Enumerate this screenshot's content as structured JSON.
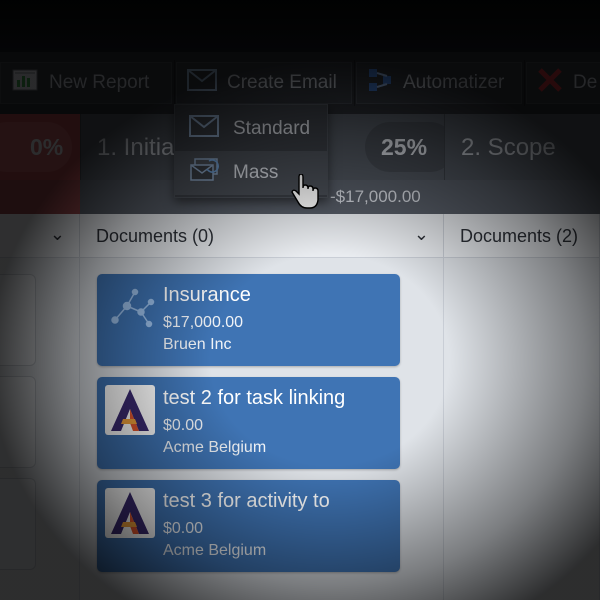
{
  "toolbar": {
    "new_report_label": "New Report",
    "create_email_label": "Create Email",
    "automatizer_label": "Automatizer",
    "delete_label": "De",
    "icons": [
      "report-icon",
      "envelope-icon",
      "flow-icon",
      "delete-x-icon"
    ]
  },
  "email_menu": {
    "items": [
      {
        "label": "Standard",
        "icon": "envelope-icon"
      },
      {
        "label": "Mass",
        "icon": "mass-email-icon"
      }
    ]
  },
  "stages": [
    {
      "pct": "0%",
      "title": "",
      "amount": ""
    },
    {
      "pct": "25%",
      "title": "1. Initia",
      "amount": "-$17,000.00"
    },
    {
      "pct": "",
      "title": "2. Scope",
      "amount": ""
    }
  ],
  "columns": [
    {
      "header": ""
    },
    {
      "header": "Documents (0)"
    },
    {
      "header": "Documents (2)"
    }
  ],
  "cards": [
    {
      "title": "Insurance",
      "amount": "$17,000.00",
      "company": "Bruen Inc",
      "thumb": "molecule-icon"
    },
    {
      "title": "test 2 for task linking",
      "amount": "$0.00",
      "company": "Acme Belgium",
      "thumb": "a-logo-icon"
    },
    {
      "title": "test 3 for activity to",
      "amount": "$0.00",
      "company": "Acme Belgium",
      "thumb": "a-logo-icon"
    }
  ],
  "colors": {
    "card_blue": "#3f74b4",
    "stage_red": "#b04a4e",
    "toolbar": "#2a2d33"
  }
}
